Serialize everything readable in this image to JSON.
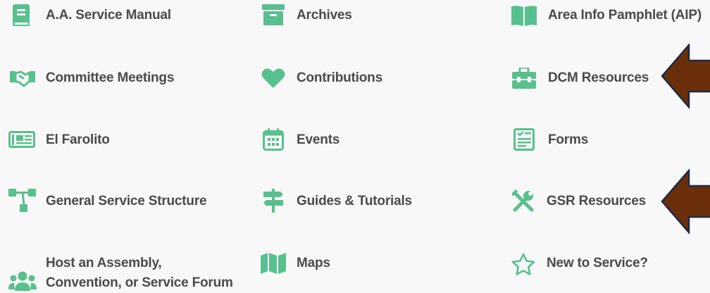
{
  "colors": {
    "accent": "#58c08e",
    "text": "#4a4a4a",
    "arrow_fill": "#6b2e0b",
    "arrow_outline": "#1f2a44",
    "background": "#f8f8f8"
  },
  "links": [
    {
      "label": "A.A. Service Manual",
      "icon": "book-icon"
    },
    {
      "label": "Archives",
      "icon": "archive-box-icon"
    },
    {
      "label": "Area Info Pamphlet (AIP)",
      "icon": "open-book-icon"
    },
    {
      "label": "Committee Meetings",
      "icon": "handshake-icon"
    },
    {
      "label": "Contributions",
      "icon": "heart-icon"
    },
    {
      "label": "DCM Resources",
      "icon": "toolbox-icon"
    },
    {
      "label": "El Farolito",
      "icon": "newspaper-icon"
    },
    {
      "label": "Events",
      "icon": "calendar-icon"
    },
    {
      "label": "Forms",
      "icon": "form-icon"
    },
    {
      "label": "General Service Structure",
      "icon": "sitemap-icon"
    },
    {
      "label": "Guides & Tutorials",
      "icon": "signpost-icon"
    },
    {
      "label": "GSR Resources",
      "icon": "tools-icon"
    },
    {
      "label_line1": "Host an Assembly,",
      "label_line2": "Convention, or Service Forum",
      "icon": "users-icon"
    },
    {
      "label": "Maps",
      "icon": "map-icon"
    },
    {
      "label": "New to Service?",
      "icon": "star-outline-icon"
    }
  ],
  "annotations": [
    {
      "points_to": "DCM Resources",
      "icon": "arrow-left-icon"
    },
    {
      "points_to": "GSR Resources",
      "icon": "arrow-left-icon"
    }
  ]
}
